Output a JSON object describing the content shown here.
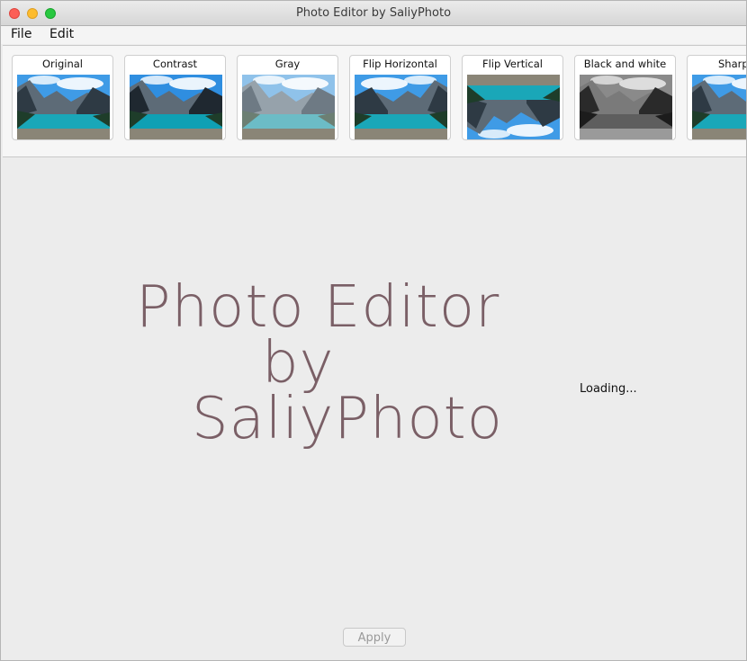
{
  "window": {
    "title": "Photo Editor by SaliyPhoto"
  },
  "menu": {
    "file": "File",
    "edit": "Edit"
  },
  "filters": [
    {
      "label": "Original",
      "style": "color"
    },
    {
      "label": "Contrast",
      "style": "contrast"
    },
    {
      "label": "Gray",
      "style": "faded"
    },
    {
      "label": "Flip Horizontal",
      "style": "flip-h"
    },
    {
      "label": "Flip Vertical",
      "style": "flip-v"
    },
    {
      "label": "Black and white",
      "style": "bw"
    },
    {
      "label": "Sharp",
      "style": "color"
    }
  ],
  "splash": {
    "line1": "Photo Editor",
    "line2": "by",
    "line3": "SaliyPhoto",
    "loading": "Loading..."
  },
  "footer": {
    "apply": "Apply"
  },
  "colors": {
    "splash_text": "#7a5f66",
    "lake": "#1aa7b8",
    "sky": "#3f9be6"
  }
}
